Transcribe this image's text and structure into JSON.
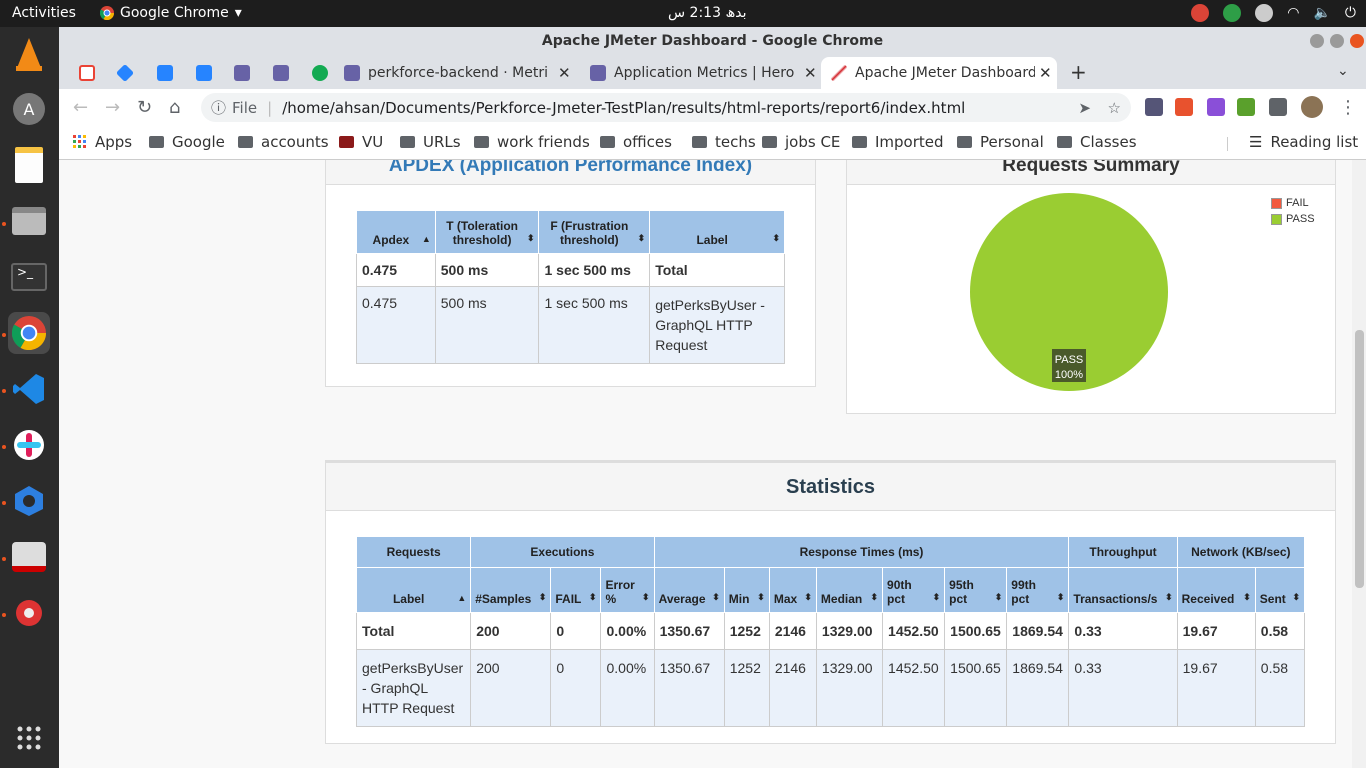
{
  "os": {
    "activities": "Activities",
    "app_name": "Google Chrome",
    "clock": "بدھ  2:13 س"
  },
  "window": {
    "title": "Apache JMeter Dashboard - Google Chrome"
  },
  "tabs": [
    {
      "label": "perkforce-backend · Metri",
      "icon_color": "#6762a6"
    },
    {
      "label": "Application Metrics | Hero",
      "icon_color": "#6762a6"
    },
    {
      "label": "Apache JMeter Dashboard",
      "icon_color": "#d22128"
    }
  ],
  "pinned_tab_icons": [
    "gmail-icon",
    "jira-icon",
    "bitbucket-icon",
    "bitbucket-icon",
    "heroku-icon",
    "heroku-icon",
    "mongodb-icon"
  ],
  "address_bar": {
    "scheme": "File",
    "url": "/home/ahsan/Documents/Perkforce-Jmeter-TestPlan/results/html-reports/report6/index.html"
  },
  "bookmarks": [
    "Apps",
    "Google",
    "accounts",
    "VU",
    "URLs",
    "work friends",
    "offices",
    "techs",
    "jobs CE",
    "Imported",
    "Personal",
    "Classes"
  ],
  "reading_list": "Reading list",
  "apdex": {
    "title": "APDEX (Application Performance Index)",
    "headers": [
      "Apdex",
      "T (Toleration threshold)",
      "F (Frustration threshold)",
      "Label"
    ],
    "total": [
      "0.475",
      "500 ms",
      "1 sec 500 ms",
      "Total"
    ],
    "rows": [
      [
        "0.475",
        "500 ms",
        "1 sec 500 ms",
        "getPerksByUser - GraphQL HTTP Request"
      ]
    ]
  },
  "requests_summary": {
    "title": "Requests Summary",
    "legend": [
      {
        "label": "FAIL",
        "color": "#f15a3f"
      },
      {
        "label": "PASS",
        "color": "#9acd32"
      }
    ],
    "slice_label": "PASS",
    "slice_pct": "100%"
  },
  "chart_data": {
    "type": "pie",
    "title": "Requests Summary",
    "categories": [
      "FAIL",
      "PASS"
    ],
    "values": [
      0,
      100
    ]
  },
  "statistics": {
    "title": "Statistics",
    "groups": [
      "Requests",
      "Executions",
      "Response Times (ms)",
      "Throughput",
      "Network (KB/sec)"
    ],
    "headers": [
      "Label",
      "#Samples",
      "FAIL",
      "Error %",
      "Average",
      "Min",
      "Max",
      "Median",
      "90th pct",
      "95th pct",
      "99th pct",
      "Transactions/s",
      "Received",
      "Sent"
    ],
    "total": [
      "Total",
      "200",
      "0",
      "0.00%",
      "1350.67",
      "1252",
      "2146",
      "1329.00",
      "1452.50",
      "1500.65",
      "1869.54",
      "0.33",
      "19.67",
      "0.58"
    ],
    "rows": [
      [
        "getPerksByUser - GraphQL HTTP Request",
        "200",
        "0",
        "0.00%",
        "1350.67",
        "1252",
        "2146",
        "1329.00",
        "1452.50",
        "1500.65",
        "1869.54",
        "0.33",
        "19.67",
        "0.58"
      ]
    ]
  }
}
